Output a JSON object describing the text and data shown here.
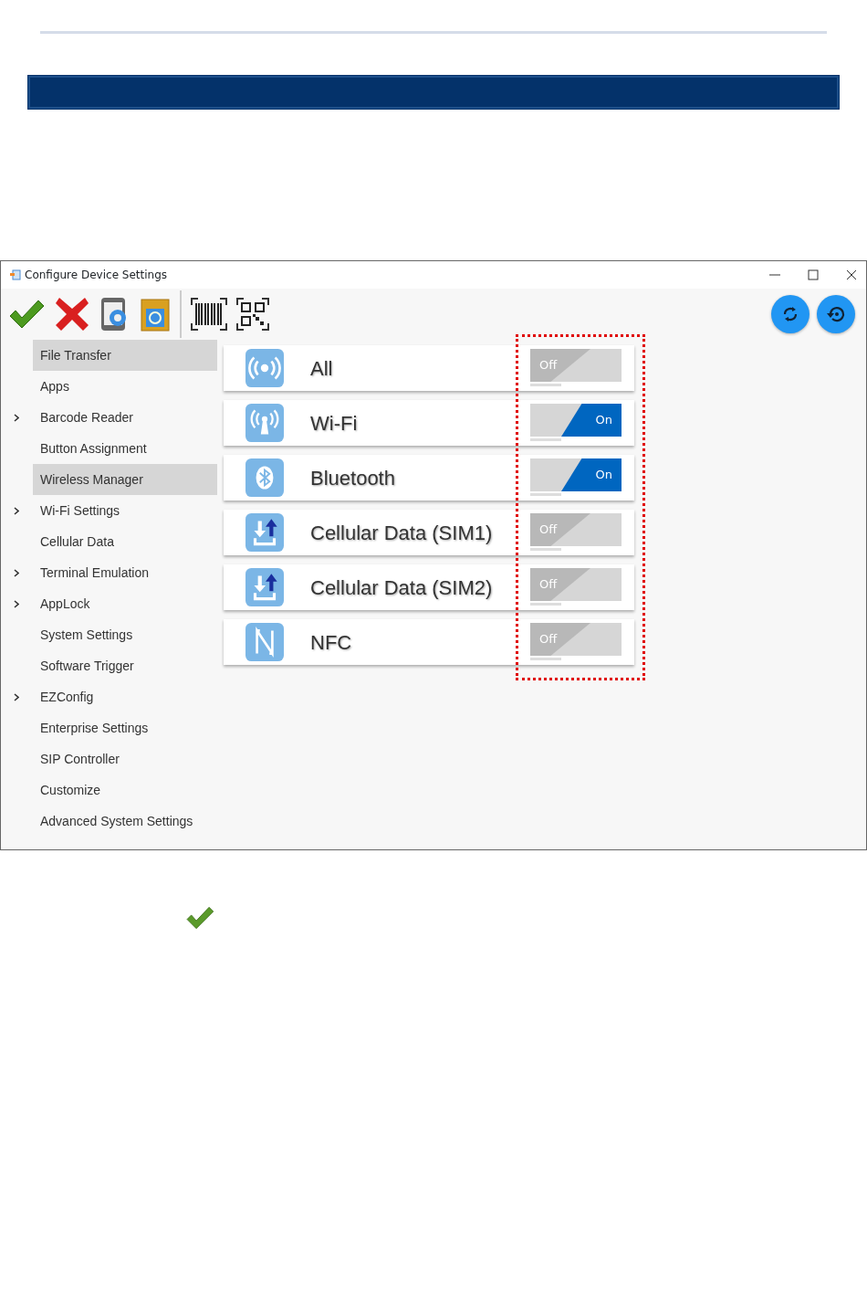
{
  "window": {
    "title": "Configure Device Settings"
  },
  "sidebar": {
    "items": [
      {
        "label": "File Transfer",
        "expandable": false,
        "selected": true
      },
      {
        "label": "Apps",
        "expandable": false,
        "selected": false
      },
      {
        "label": "Barcode Reader",
        "expandable": true,
        "selected": false
      },
      {
        "label": "Button Assignment",
        "expandable": false,
        "selected": false
      },
      {
        "label": "Wireless Manager",
        "expandable": false,
        "selected": true
      },
      {
        "label": "Wi-Fi Settings",
        "expandable": true,
        "selected": false
      },
      {
        "label": "Cellular Data",
        "expandable": false,
        "selected": false
      },
      {
        "label": "Terminal Emulation",
        "expandable": true,
        "selected": false
      },
      {
        "label": "AppLock",
        "expandable": true,
        "selected": false
      },
      {
        "label": "System Settings",
        "expandable": false,
        "selected": false
      },
      {
        "label": "Software Trigger",
        "expandable": false,
        "selected": false
      },
      {
        "label": "EZConfig",
        "expandable": true,
        "selected": false
      },
      {
        "label": "Enterprise Settings",
        "expandable": false,
        "selected": false
      },
      {
        "label": "SIP Controller",
        "expandable": false,
        "selected": false
      },
      {
        "label": "Customize",
        "expandable": false,
        "selected": false
      },
      {
        "label": "Advanced System Settings",
        "expandable": false,
        "selected": false
      }
    ]
  },
  "wireless": [
    {
      "kind": "all",
      "label": "All",
      "on": false,
      "toggle_text": "Off"
    },
    {
      "kind": "wifi",
      "label": "Wi-Fi",
      "on": true,
      "toggle_text": "On"
    },
    {
      "kind": "bluetooth",
      "label": "Bluetooth",
      "on": true,
      "toggle_text": "On"
    },
    {
      "kind": "cellular",
      "label": "Cellular Data (SIM1)",
      "on": false,
      "toggle_text": "Off"
    },
    {
      "kind": "cellular",
      "label": "Cellular Data (SIM2)",
      "on": false,
      "toggle_text": "Off"
    },
    {
      "kind": "nfc",
      "label": "NFC",
      "on": false,
      "toggle_text": "Off"
    }
  ]
}
